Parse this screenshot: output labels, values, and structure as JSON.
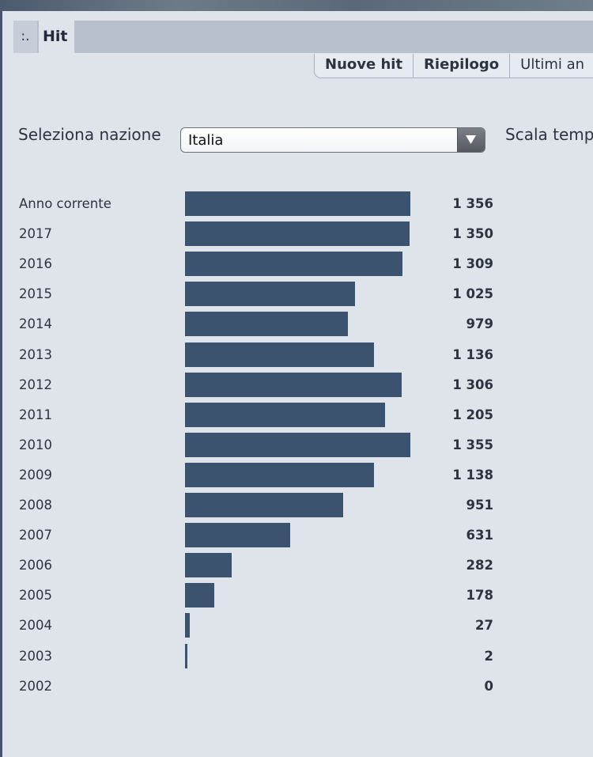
{
  "panel": {
    "title_bullet": ":.",
    "title": "Hit"
  },
  "tabs": [
    {
      "label": "Nuove hit",
      "bold": true
    },
    {
      "label": "Riepilogo",
      "bold": true
    },
    {
      "label": "Ultimi an",
      "bold": false
    }
  ],
  "filters": {
    "nation_label": "Seleziona nazione",
    "nation_value": "Italia",
    "scale_label": "Scala temp"
  },
  "colors": {
    "bar": "#3c5370",
    "background": "#dfe4ea"
  },
  "chart_data": {
    "type": "bar",
    "orientation": "horizontal",
    "categories": [
      "Anno corrente",
      "2017",
      "2016",
      "2015",
      "2014",
      "2013",
      "2012",
      "2011",
      "2010",
      "2009",
      "2008",
      "2007",
      "2006",
      "2005",
      "2004",
      "2003",
      "2002"
    ],
    "values": [
      1356,
      1350,
      1309,
      1025,
      979,
      1136,
      1306,
      1205,
      1355,
      1138,
      951,
      631,
      282,
      178,
      27,
      2,
      0
    ],
    "value_labels": [
      "1 356",
      "1 350",
      "1 309",
      "1 025",
      "979",
      "1 136",
      "1 306",
      "1 205",
      "1 355",
      "1 138",
      "951",
      "631",
      "282",
      "178",
      "27",
      "2",
      "0"
    ],
    "title": "",
    "xlabel": "",
    "ylabel": ""
  }
}
